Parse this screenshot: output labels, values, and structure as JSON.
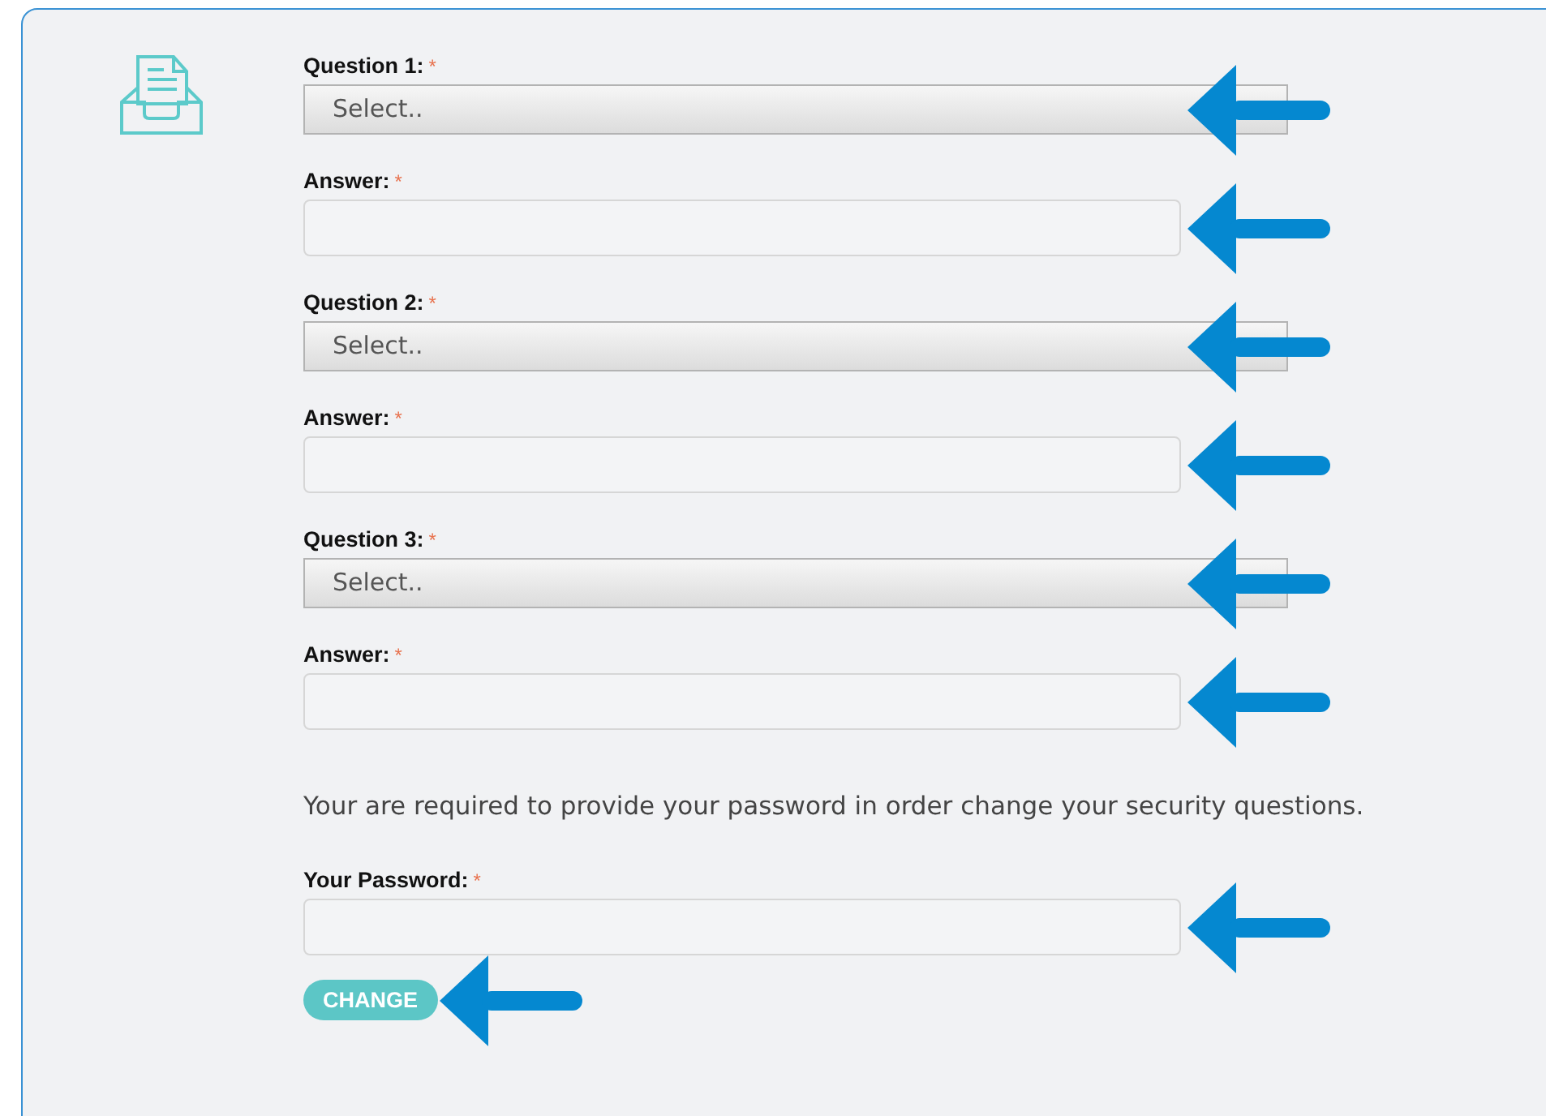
{
  "fields": [
    {
      "kind": "select",
      "label": "Question 1:",
      "required_mark": "*",
      "value": "Select.."
    },
    {
      "kind": "text",
      "label": "Answer:",
      "required_mark": "*"
    },
    {
      "kind": "select",
      "label": "Question 2:",
      "required_mark": "*",
      "value": "Select.."
    },
    {
      "kind": "text",
      "label": "Answer:",
      "required_mark": "*"
    },
    {
      "kind": "select",
      "label": "Question 3:",
      "required_mark": "*",
      "value": "Select.."
    },
    {
      "kind": "text",
      "label": "Answer:",
      "required_mark": "*"
    }
  ],
  "note": "Your are required to provide your password in order change your security questions.",
  "password": {
    "label": "Your Password:",
    "required_mark": "*"
  },
  "button": "CHANGE"
}
